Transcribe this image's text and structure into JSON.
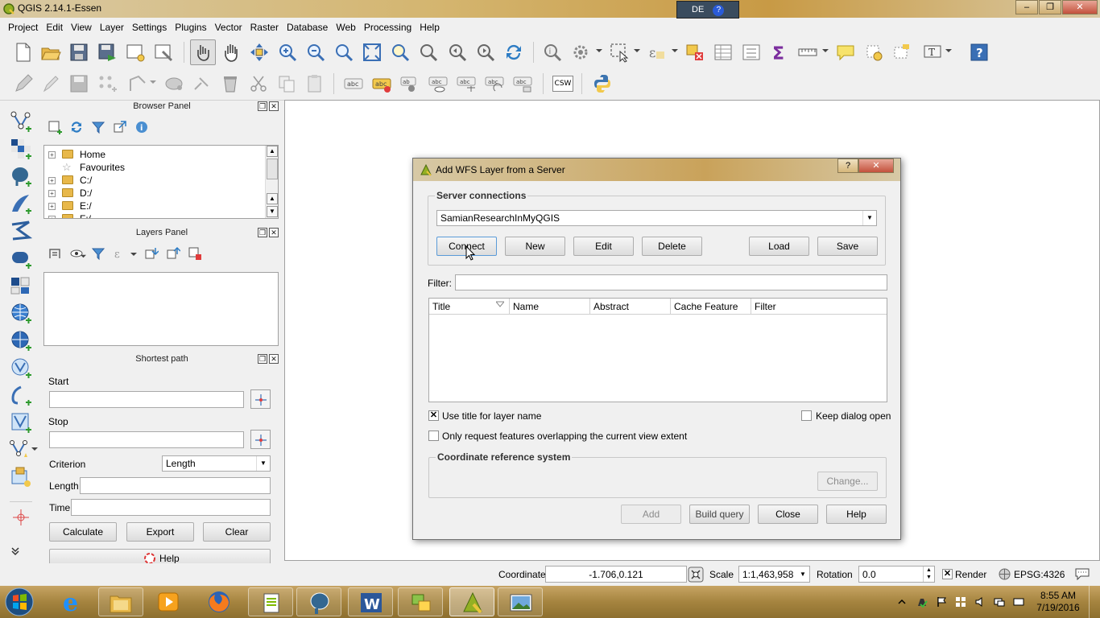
{
  "window": {
    "title": "QGIS 2.14.1-Essen",
    "language_indicator": "DE",
    "help_glyph": "?"
  },
  "menubar": [
    "Project",
    "Edit",
    "View",
    "Layer",
    "Settings",
    "Plugins",
    "Vector",
    "Raster",
    "Database",
    "Web",
    "Processing",
    "Help"
  ],
  "toolbar2": {
    "csw_label": "CSW"
  },
  "browser_panel": {
    "title": "Browser Panel",
    "items": [
      {
        "label": "Home",
        "expandable": true,
        "icon": "folder-icon"
      },
      {
        "label": "Favourites",
        "expandable": false,
        "icon": "star-icon"
      },
      {
        "label": "C:/",
        "expandable": true,
        "icon": "folder-icon"
      },
      {
        "label": "D:/",
        "expandable": true,
        "icon": "folder-icon"
      },
      {
        "label": "E:/",
        "expandable": true,
        "icon": "folder-icon"
      },
      {
        "label": "F:/",
        "expandable": true,
        "icon": "folder-icon"
      }
    ]
  },
  "layers_panel": {
    "title": "Layers Panel"
  },
  "shortest_path": {
    "title": "Shortest path",
    "start_label": "Start",
    "stop_label": "Stop",
    "criterion_label": "Criterion",
    "criterion_value": "Length",
    "length_label": "Length",
    "time_label": "Time",
    "calculate_label": "Calculate",
    "export_label": "Export",
    "clear_label": "Clear",
    "help_label": "Help"
  },
  "dialog": {
    "title": "Add WFS Layer from a Server",
    "server_connections_title": "Server connections",
    "selected_connection": "SamianResearchInMyQGIS",
    "buttons": {
      "connect": "Connect",
      "new": "New",
      "edit": "Edit",
      "delete": "Delete",
      "load": "Load",
      "save": "Save"
    },
    "filter_label": "Filter:",
    "table_columns": [
      "Title",
      "Name",
      "Abstract",
      "Cache Feature",
      "Filter"
    ],
    "use_title_label": "Use title for layer name",
    "use_title_checked": true,
    "keep_open_label": "Keep dialog open",
    "keep_open_checked": false,
    "only_request_label": "Only request features overlapping the current view extent",
    "only_request_checked": false,
    "crs_title": "Coordinate reference system",
    "change_label": "Change...",
    "footer": {
      "add": "Add",
      "build_query": "Build query",
      "close": "Close",
      "help": "Help"
    }
  },
  "statusbar": {
    "coordinate_label": "Coordinate",
    "coordinate_value": "-1.706,0.121",
    "scale_label": "Scale",
    "scale_value": "1:1,463,958",
    "rotation_label": "Rotation",
    "rotation_value": "0.0",
    "render_label": "Render",
    "render_checked": true,
    "crs_label": "EPSG:4326"
  },
  "taskbar": {
    "apps": [
      "start-orb",
      "internet-explorer",
      "file-explorer",
      "media-player",
      "firefox",
      "notepad-plus-plus",
      "postgresql",
      "word",
      "winscp",
      "qgis",
      "photo-viewer"
    ],
    "time": "8:55 AM",
    "date": "7/19/2016"
  }
}
